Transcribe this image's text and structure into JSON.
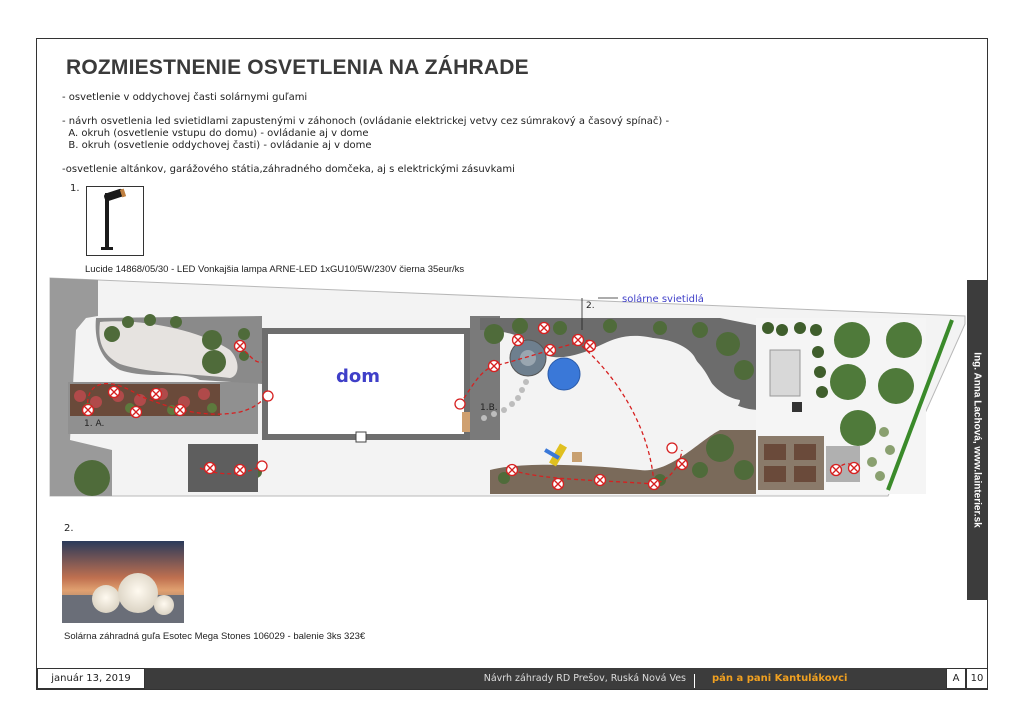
{
  "header": {
    "title": "ROZMIESTNENIE OSVETLENIA NA ZÁHRADE"
  },
  "notes": {
    "line1": "- osvetlenie v oddychovej časti solárnymi guľami",
    "line2": "- návrh osvetlenia led svietidlami zapustenými v záhonoch (ovládanie elektrickej vetvy cez súmrakový a časový spínač) -",
    "line3": "  A. okruh (osvetlenie vstupu do domu) - ovládanie aj v dome",
    "line4": "  B. okruh (osvetlenie oddychovej časti) - ovládanie aj v dome",
    "line5": "-osvetlenie altánkov, garážového státia,záhradného domčeka, aj s elektrickými zásuvkami"
  },
  "product1": {
    "number": "1.",
    "caption": "Lucide 14868/05/30 - LED Vonkajšia lampa ARNE-LED 1xGU10/5W/230V čierna 35eur/ks"
  },
  "product2": {
    "number": "2.",
    "caption": "Solárna záhradná guľa Esotec Mega Stones 106029 - balenie 3ks 323€"
  },
  "plan": {
    "house_label": "dom",
    "circuit_a_label": "1. A.",
    "circuit_b_label": "1.B.",
    "solar_number": "2.",
    "solar_label": "solárne svietidlá",
    "colors": {
      "lawn": "#f4f4f4",
      "pavement": "#8a8a8a",
      "house_wall": "#6e6e6e",
      "circuit_line": "#d62020",
      "house_label": "#3f3fc8",
      "solar_label": "#3f3fc8",
      "pool": "#3a78d8"
    }
  },
  "sidebar": {
    "author": "Ing. Anna Lachová, www.lainterier.sk"
  },
  "footer": {
    "date": "január 13, 2019",
    "project": "Návrh záhrady RD Prešov,  Ruská Nová Ves",
    "client": "pán a pani Kantulákovci",
    "sheet_size": "A",
    "page": "10"
  },
  "icons": {
    "light_marker": "crossed-circle-icon",
    "lamp": "spot-lamp-icon",
    "globes": "solar-globe-photo"
  }
}
